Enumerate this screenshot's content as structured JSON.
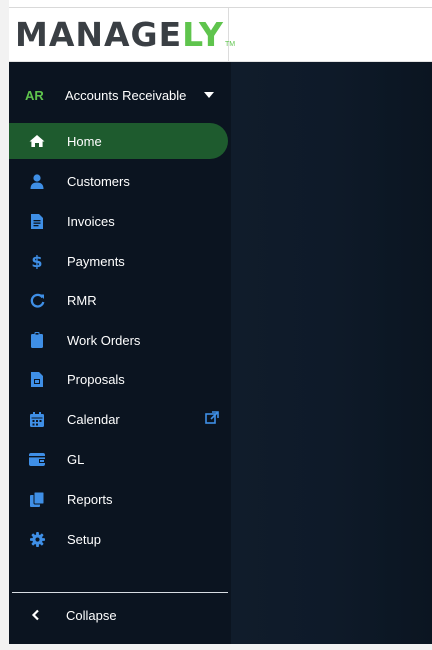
{
  "brand": {
    "logo_main": "MANAGE",
    "logo_accent": "LY",
    "logo_tm": "TM",
    "accent_color": "#5fc44d",
    "active_bg": "#1e5b2e"
  },
  "module": {
    "abbr": "AR",
    "name": "Accounts Receivable",
    "dropdown_icon": "caret-down-icon"
  },
  "nav": {
    "items": [
      {
        "label": "Home",
        "icon": "home-icon"
      },
      {
        "label": "Customers",
        "icon": "user-icon"
      },
      {
        "label": "Invoices",
        "icon": "invoice-icon"
      },
      {
        "label": "Payments",
        "icon": "dollar-icon"
      },
      {
        "label": "RMR",
        "icon": "refresh-icon"
      },
      {
        "label": "Work Orders",
        "icon": "clipboard-icon"
      },
      {
        "label": "Proposals",
        "icon": "document-icon"
      },
      {
        "label": "Calendar",
        "icon": "calendar-icon",
        "external_icon": "external-link-icon"
      },
      {
        "label": "GL",
        "icon": "wallet-icon"
      },
      {
        "label": "Reports",
        "icon": "copy-icon"
      },
      {
        "label": "Setup",
        "icon": "gear-icon"
      }
    ],
    "active_index": 0
  },
  "collapse": {
    "label": "Collapse",
    "icon": "chevron-left-icon"
  }
}
